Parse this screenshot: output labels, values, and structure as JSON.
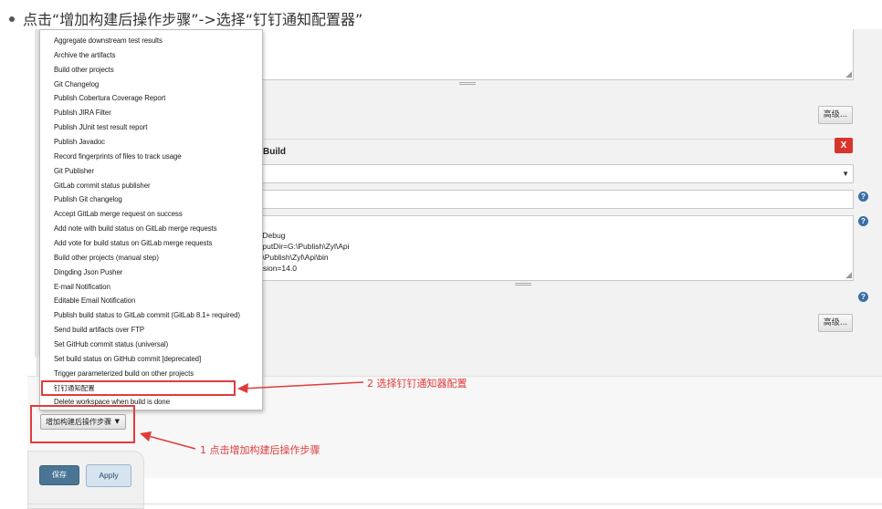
{
  "heading": {
    "text": "点击“增加构建后操作步骤”->选择“钉钉通知配置器”"
  },
  "dropdown_menu": {
    "items": [
      "Aggregate downstream test results",
      "Archive the artifacts",
      "Build other projects",
      "Git Changelog",
      "Publish Cobertura Coverage Report",
      "Publish JIRA Filter",
      "Publish JUnit test result report",
      "Publish Javadoc",
      "Record fingerprints of files to track usage",
      "Git Publisher",
      "GitLab commit status publisher",
      "Publish Git changelog",
      "Accept GitLab merge request on success",
      "Add note with build status on GitLab merge requests",
      "Add vote for build status on GitLab merge requests",
      "Build other projects (manual step)",
      "Dingding Json Pusher",
      "E-mail Notification",
      "Editable Email Notification",
      "Publish build status to GitLab commit (GitLab 8.1+ required)",
      "Send build artifacts over FTP",
      "Set GitHub commit status (universal)",
      "Set build status on GitHub commit [deprecated]",
      "Trigger parameterized build on other projects",
      "钉钉通知配置",
      "Delete workspace when build is done"
    ]
  },
  "config_form": {
    "advanced_label": "高级...",
    "delete_label": "X",
    "section_title_partial": "Build",
    "textarea_lines": [
      ":Debug",
      "tputDir=G:\\Publish\\Zyl\\Api",
      ":\\Publish\\Zyl\\Api\\bin",
      "rsion=14.0"
    ],
    "help_symbol": "?"
  },
  "footer": {
    "add_post_build_label": "增加构建后操作步骤",
    "save_label": "保存",
    "apply_label": "Apply"
  },
  "annotations": {
    "step2": "2 选择钉钉通知器配置",
    "step1": "1 点击增加构建后操作步骤"
  },
  "colors": {
    "annotation_red": "#e03c3c",
    "save_blue": "#4a7594",
    "delete_red": "#d9342b"
  }
}
